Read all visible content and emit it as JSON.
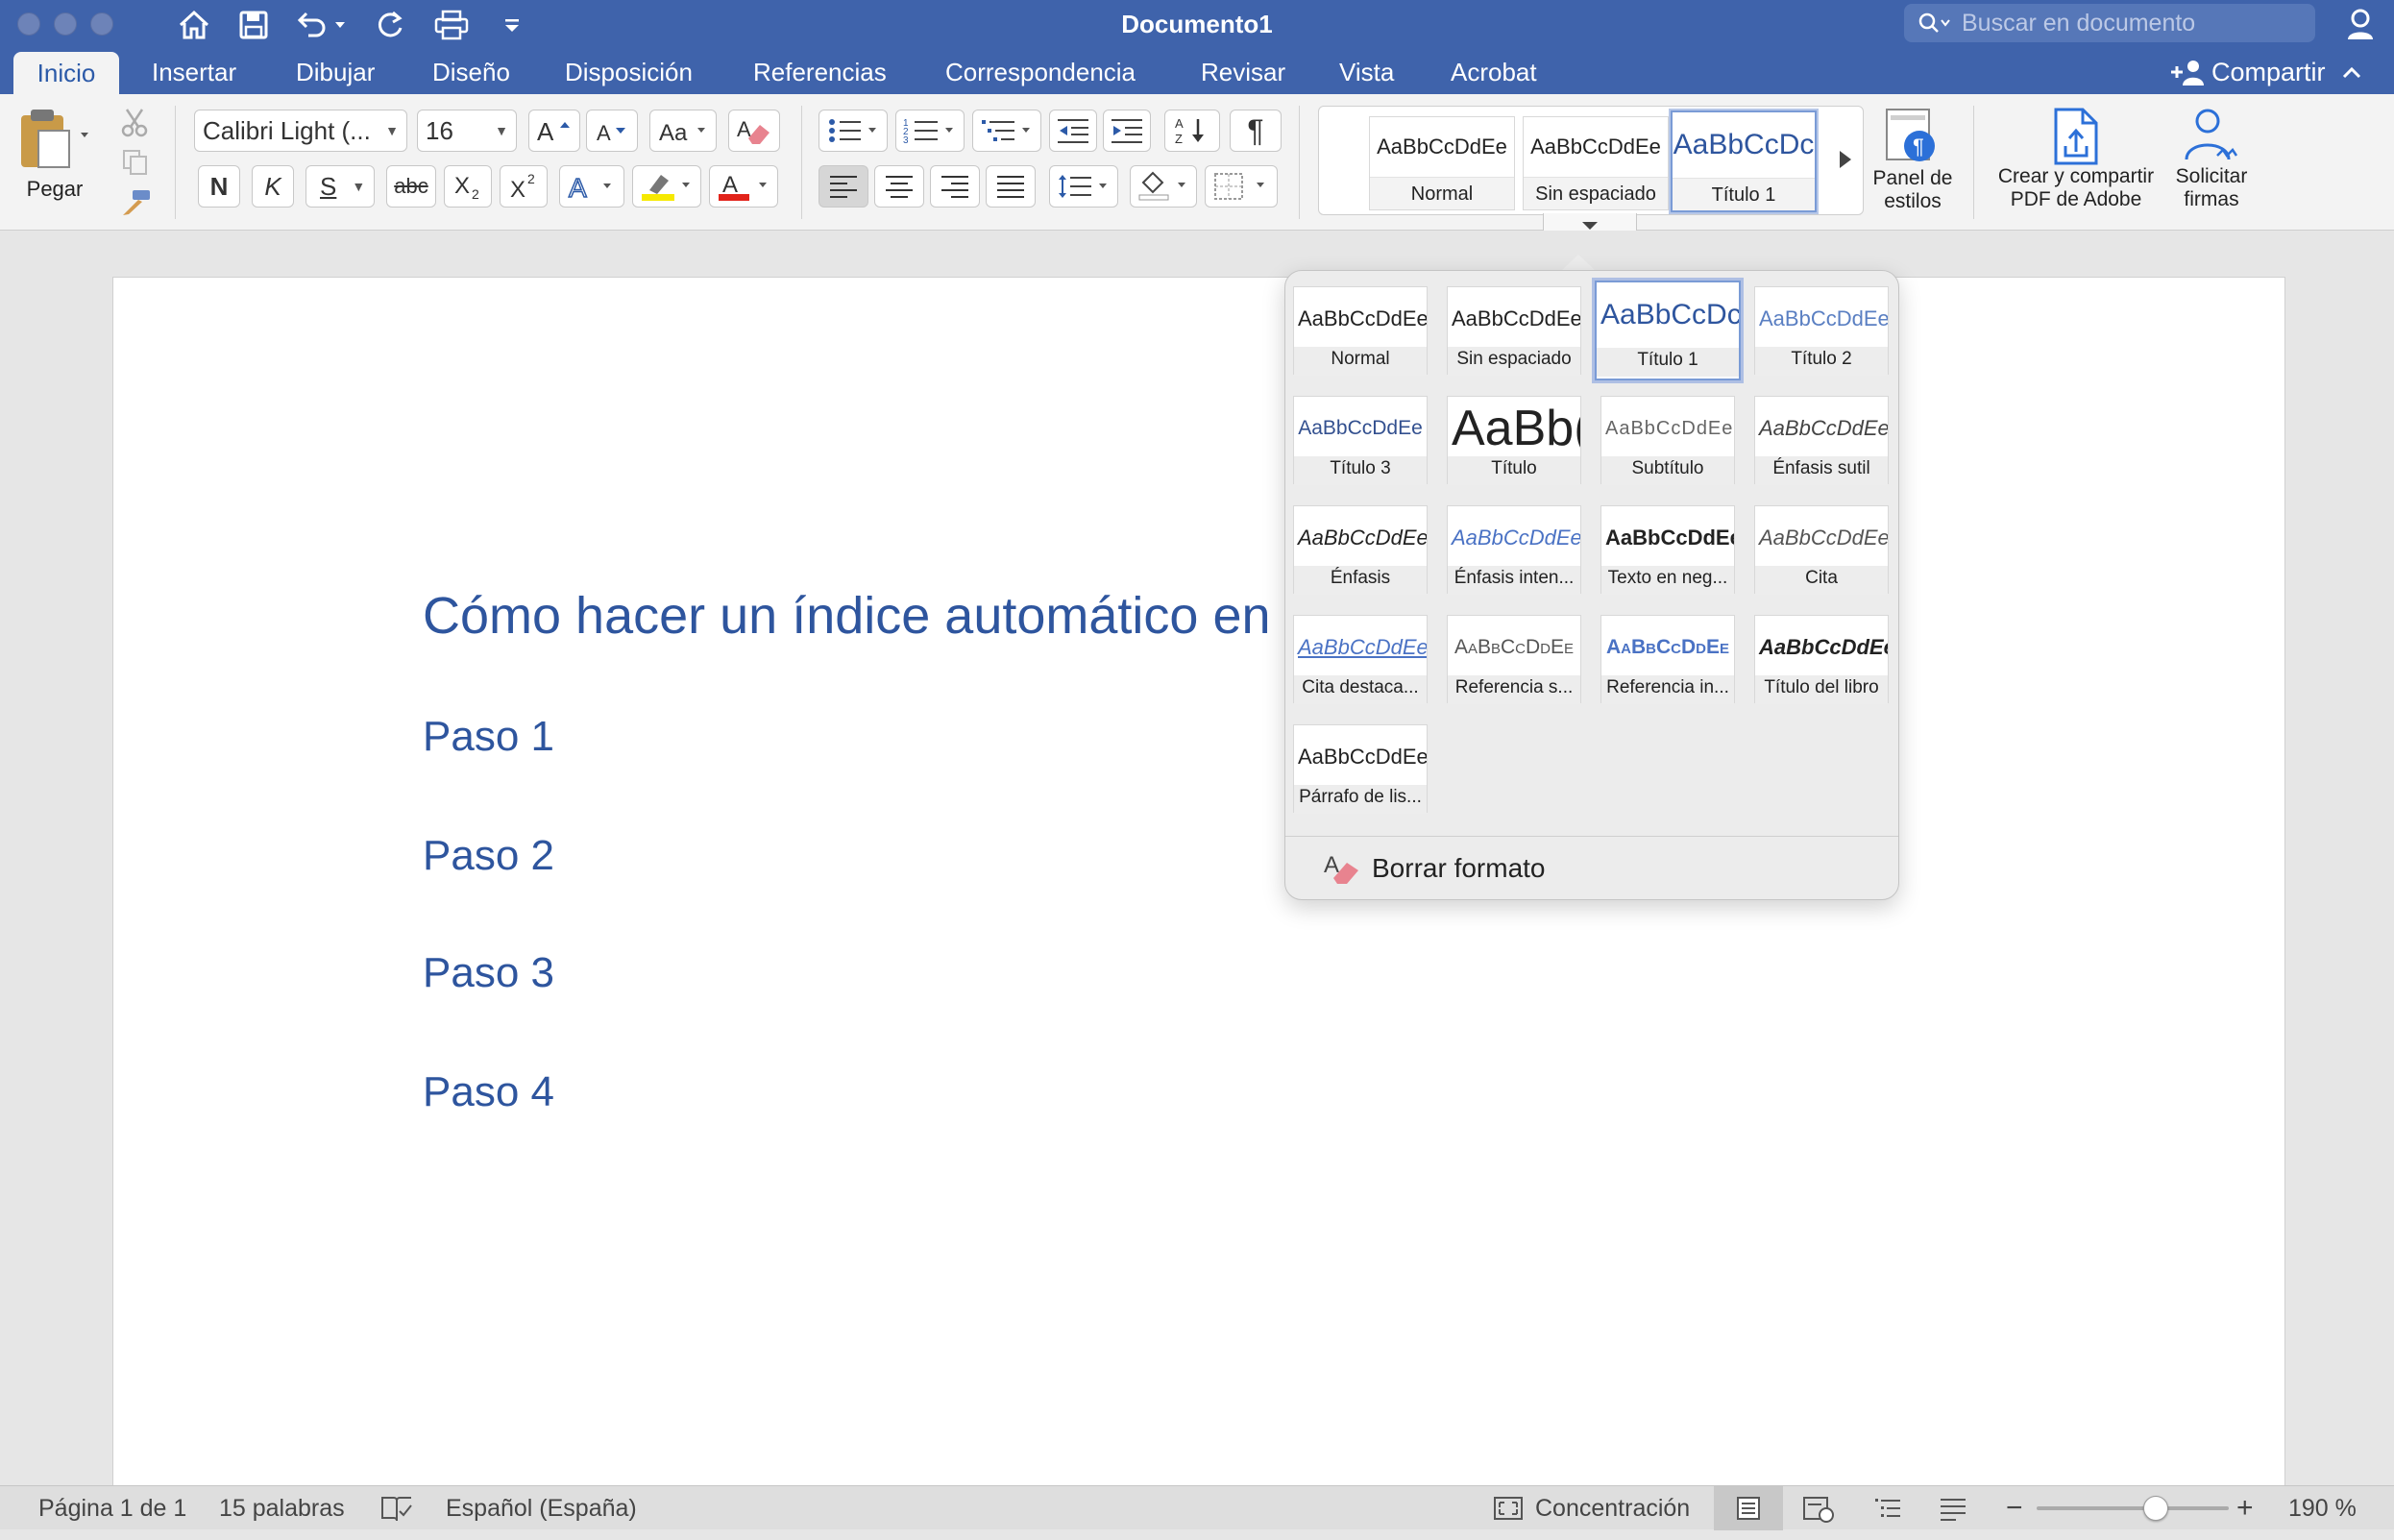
{
  "titlebar": {
    "doc_title": "Documento1",
    "search_placeholder": "Buscar en documento"
  },
  "tabs": [
    "Inicio",
    "Insertar",
    "Dibujar",
    "Diseño",
    "Disposición",
    "Referencias",
    "Correspondencia",
    "Revisar",
    "Vista",
    "Acrobat"
  ],
  "share_label": "Compartir",
  "ribbon": {
    "paste_label": "Pegar",
    "font_name": "Calibri Light (...",
    "font_size": "16",
    "bold": "N",
    "italic": "K",
    "underline": "S",
    "strike": "abc",
    "gallery": [
      {
        "sample": "AaBbCcDdEe",
        "label": "Normal"
      },
      {
        "sample": "AaBbCcDdEe",
        "label": "Sin espaciado"
      },
      {
        "sample": "AaBbCcDc",
        "label": "Título 1"
      }
    ],
    "styles_pane": "Panel de estilos",
    "adobe_pdf_line1": "Crear y compartir",
    "adobe_pdf_line2": "PDF de Adobe",
    "sign_line1": "Solicitar",
    "sign_line2": "firmas"
  },
  "document": {
    "heading": "Cómo hacer un índice automático en",
    "steps": [
      "Paso 1",
      "Paso 2",
      "Paso 3",
      "Paso 4"
    ]
  },
  "styles_popup": {
    "items": [
      {
        "sample": "AaBbCcDdEe",
        "label": "Normal"
      },
      {
        "sample": "AaBbCcDdEe",
        "label": "Sin espaciado"
      },
      {
        "sample": "AaBbCcDc",
        "label": "Título 1"
      },
      {
        "sample": "AaBbCcDdEe",
        "label": "Título 2"
      },
      {
        "sample": "AaBbCcDdEe",
        "label": "Título 3"
      },
      {
        "sample": "AaBb(",
        "label": "Título"
      },
      {
        "sample": "AaBbCcDdEe",
        "label": "Subtítulo"
      },
      {
        "sample": "AaBbCcDdEe",
        "label": "Énfasis sutil"
      },
      {
        "sample": "AaBbCcDdEe",
        "label": "Énfasis"
      },
      {
        "sample": "AaBbCcDdEe",
        "label": "Énfasis inten..."
      },
      {
        "sample": "AaBbCcDdEe",
        "label": "Texto en neg..."
      },
      {
        "sample": "AaBbCcDdEe",
        "label": "Cita"
      },
      {
        "sample": "AaBbCcDdEe",
        "label": "Cita destaca..."
      },
      {
        "sample": "AaBbCcDdEe",
        "label": "Referencia s..."
      },
      {
        "sample": "AaBbCcDdEe",
        "label": "Referencia in..."
      },
      {
        "sample": "AaBbCcDdEe",
        "label": "Título del libro"
      },
      {
        "sample": "AaBbCcDdEe",
        "label": "Párrafo de lis..."
      }
    ],
    "clear_format": "Borrar formato"
  },
  "statusbar": {
    "page": "Página 1 de 1",
    "words": "15 palabras",
    "language": "Español (España)",
    "focus": "Concentración",
    "zoom": "190 %",
    "zoom_level": 0.62
  },
  "colors": {
    "brand": "#3f63ab",
    "heading_text": "#2e559e"
  }
}
